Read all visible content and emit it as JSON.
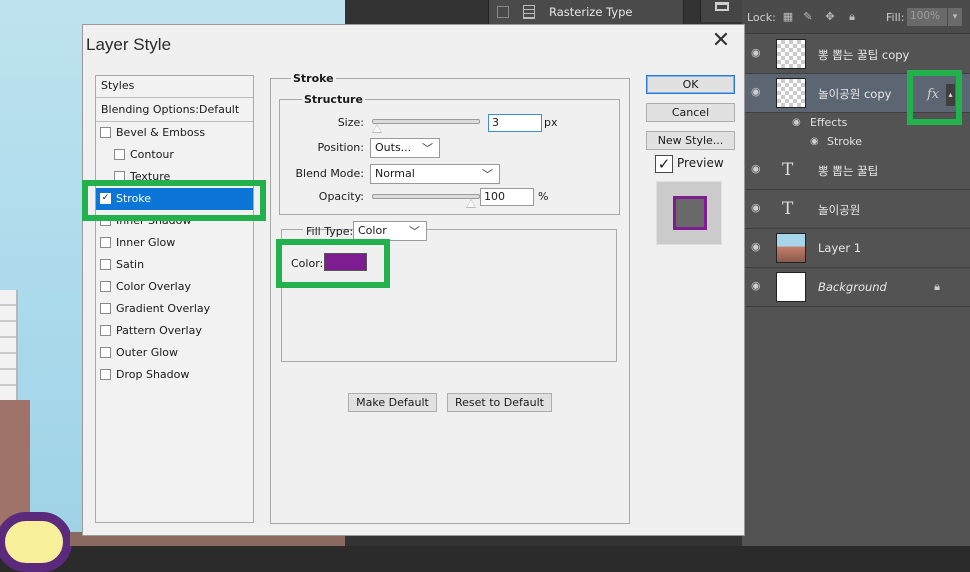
{
  "top_menu": {
    "label": "Rasterize Type"
  },
  "layers_panel": {
    "lock_label": "Lock:",
    "fill_label": "Fill:",
    "fill_value": "100%",
    "layers": [
      {
        "name": "뽕 뽑는 꿀팁 copy",
        "kind": "pixel"
      },
      {
        "name": "놀이공원 copy",
        "kind": "pixel",
        "selected": true,
        "fx": "fx"
      },
      {
        "name": "뽕 뽑는 꿀팁",
        "kind": "text",
        "glyph": "T"
      },
      {
        "name": "놀이공원",
        "kind": "text",
        "glyph": "T"
      },
      {
        "name": "Layer 1",
        "kind": "photo"
      },
      {
        "name": "Background",
        "kind": "background",
        "locked": true
      }
    ],
    "effects_label": "Effects",
    "effect_items": [
      "Stroke"
    ]
  },
  "dialog": {
    "title": "Layer Style",
    "close_glyph": "✕",
    "styles_header": "Styles",
    "blending_options": "Blending Options:Default",
    "style_items": [
      {
        "label": "Bevel & Emboss",
        "checked": false,
        "sub": false
      },
      {
        "label": "Contour",
        "checked": false,
        "sub": true
      },
      {
        "label": "Texture",
        "checked": false,
        "sub": true
      },
      {
        "label": "Stroke",
        "checked": true,
        "sub": false,
        "selected": true
      },
      {
        "label": "Inner Shadow",
        "checked": false,
        "sub": false
      },
      {
        "label": "Inner Glow",
        "checked": false,
        "sub": false
      },
      {
        "label": "Satin",
        "checked": false,
        "sub": false
      },
      {
        "label": "Color Overlay",
        "checked": false,
        "sub": false
      },
      {
        "label": "Gradient Overlay",
        "checked": false,
        "sub": false
      },
      {
        "label": "Pattern Overlay",
        "checked": false,
        "sub": false
      },
      {
        "label": "Outer Glow",
        "checked": false,
        "sub": false
      },
      {
        "label": "Drop Shadow",
        "checked": false,
        "sub": false
      }
    ],
    "stroke": {
      "group_title": "Stroke",
      "structure_title": "Structure",
      "size_label": "Size:",
      "size_value": "3",
      "size_unit": "px",
      "position_label": "Position:",
      "position_value": "Outs...",
      "blend_mode_label": "Blend Mode:",
      "blend_mode_value": "Normal",
      "opacity_label": "Opacity:",
      "opacity_value": "100",
      "opacity_unit": "%",
      "fill_type_label": "Fill Type:",
      "fill_type_value": "Color",
      "color_label": "Color:",
      "stroke_color": "#7d1d91",
      "make_default": "Make Default",
      "reset_default": "Reset to Default"
    },
    "buttons": {
      "ok": "OK",
      "cancel": "Cancel",
      "new_style": "New Style..."
    },
    "preview_label": "Preview",
    "preview_checked": true
  },
  "highlight_color": "#22b14c"
}
